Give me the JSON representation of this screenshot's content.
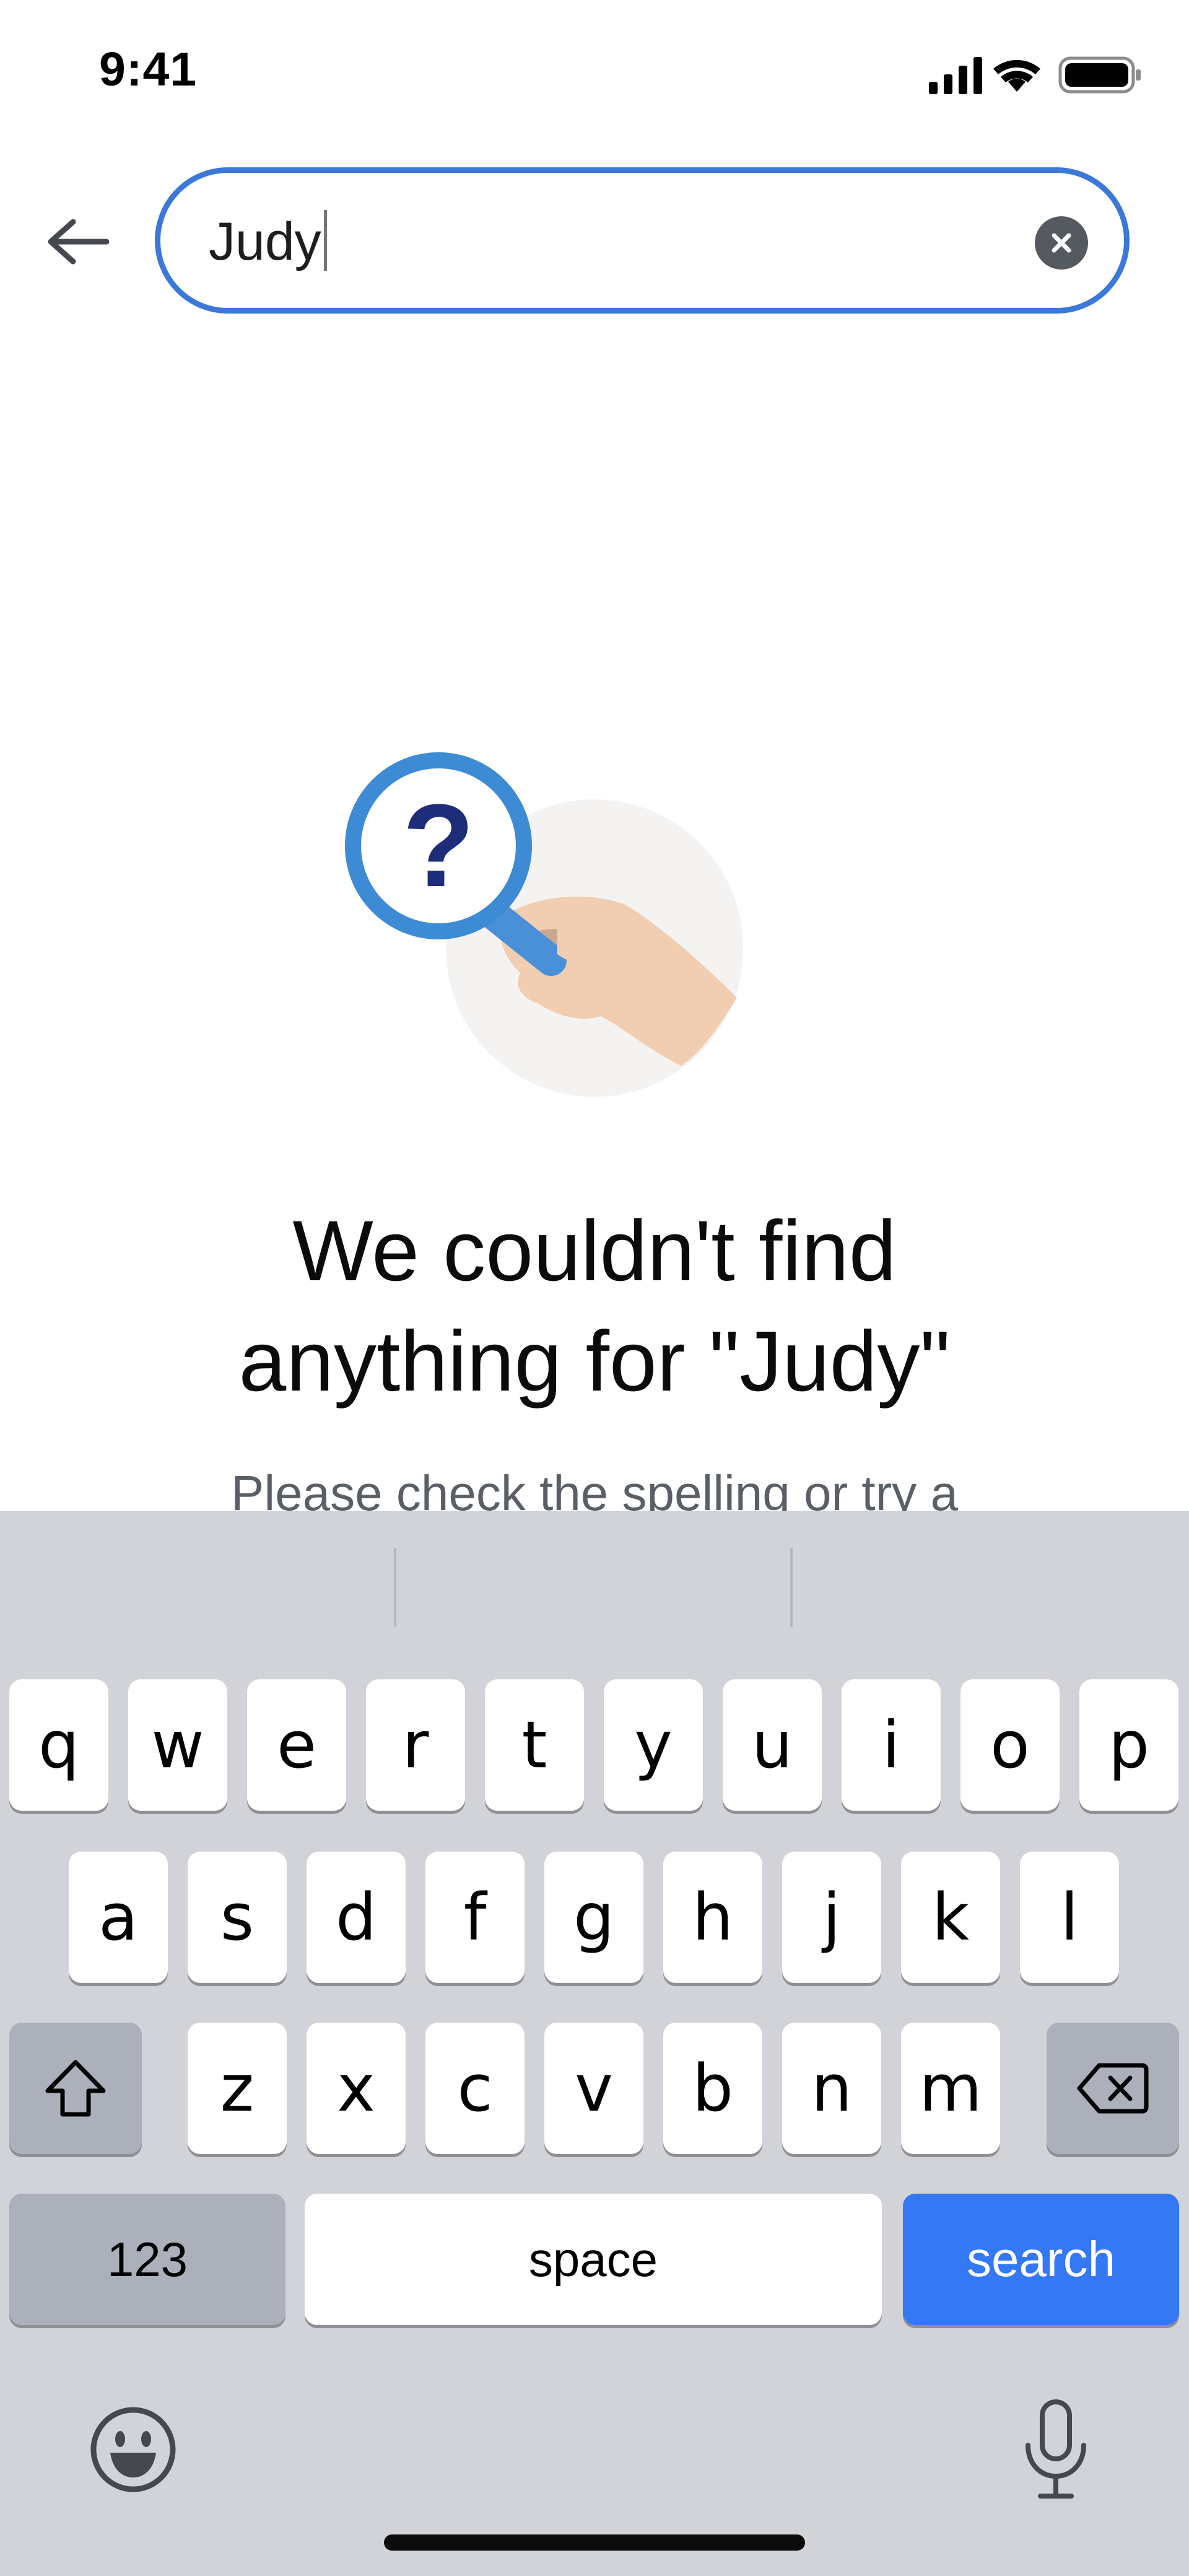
{
  "status_bar": {
    "time": "9:41",
    "icons": [
      "cellular-signal-icon",
      "wifi-icon",
      "battery-icon"
    ]
  },
  "search": {
    "value": "Judy",
    "back_icon": "arrow-left-icon",
    "clear_icon": "clear-circle-icon",
    "accent_color": "#3C78D8"
  },
  "empty_state": {
    "illustration": "magnifying-glass-question-icon",
    "title_line1": "We couldn't find",
    "title_line2": "anything for \"Judy\"",
    "subtitle": "Please check the spelling or try a"
  },
  "keyboard": {
    "row1": [
      "q",
      "w",
      "e",
      "r",
      "t",
      "y",
      "u",
      "i",
      "o",
      "p"
    ],
    "row2": [
      "a",
      "s",
      "d",
      "f",
      "g",
      "h",
      "j",
      "k",
      "l"
    ],
    "row3": [
      "z",
      "x",
      "c",
      "v",
      "b",
      "n",
      "m"
    ],
    "shift_icon": "shift-icon",
    "delete_icon": "backspace-icon",
    "numbers_label": "123",
    "space_label": "space",
    "search_label": "search",
    "emoji_icon": "emoji-icon",
    "mic_icon": "microphone-icon",
    "search_key_color": "#3478F6"
  }
}
